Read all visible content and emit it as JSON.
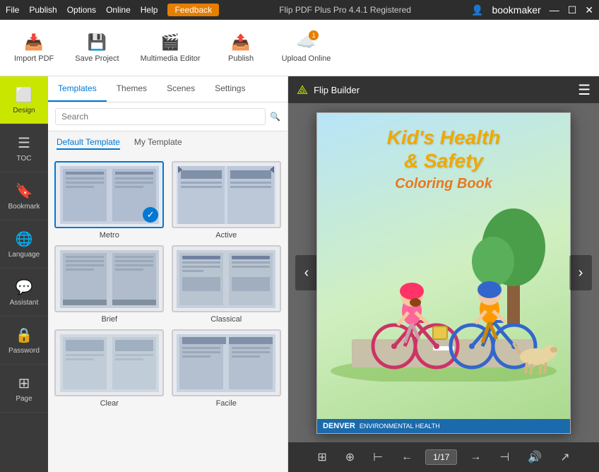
{
  "titlebar": {
    "menu_items": [
      "File",
      "Publish",
      "Options",
      "Online",
      "Help"
    ],
    "feedback_label": "Feedback",
    "app_title": "Flip PDF Plus Pro 4.4.1 Registered",
    "user_icon": "👤",
    "username": "bookmaker",
    "minimize": "—",
    "maximize": "☐",
    "close": "✕"
  },
  "toolbar": {
    "import_label": "Import PDF",
    "save_label": "Save Project",
    "multimedia_label": "Multimedia Editor",
    "publish_label": "Publish",
    "upload_label": "Upload Online"
  },
  "sidebar": {
    "items": [
      {
        "id": "design",
        "label": "Design",
        "icon": "⬜"
      },
      {
        "id": "toc",
        "label": "TOC",
        "icon": "☰"
      },
      {
        "id": "bookmark",
        "label": "Bookmark",
        "icon": "🔖"
      },
      {
        "id": "language",
        "label": "Language",
        "icon": "🌐"
      },
      {
        "id": "assistant",
        "label": "Assistant",
        "icon": "💬"
      },
      {
        "id": "password",
        "label": "Password",
        "icon": "🔒"
      },
      {
        "id": "page",
        "label": "Page",
        "icon": "⊞"
      }
    ]
  },
  "panel": {
    "tabs": [
      "Templates",
      "Themes",
      "Scenes",
      "Settings"
    ],
    "active_tab": "Templates",
    "search_placeholder": "Search",
    "sub_tabs": [
      "Default Template",
      "My Template"
    ],
    "active_sub_tab": "Default Template",
    "templates": [
      {
        "id": "metro",
        "name": "Metro",
        "selected": true
      },
      {
        "id": "active",
        "name": "Active",
        "selected": false
      },
      {
        "id": "brief",
        "name": "Brief",
        "selected": false
      },
      {
        "id": "classical",
        "name": "Classical",
        "selected": false
      },
      {
        "id": "clear",
        "name": "Clear",
        "selected": false
      },
      {
        "id": "facile",
        "name": "Facile",
        "selected": false
      },
      {
        "id": "more1",
        "name": "",
        "selected": false
      }
    ]
  },
  "preview": {
    "header_title": "Flip Builder",
    "book_title_line1": "Kid's Health",
    "book_title_line2": "& Safety",
    "book_subtitle": "Coloring Book",
    "page_current": "1",
    "page_total": "17",
    "page_display": "1/17",
    "footer_org": "DENVER",
    "footer_sub": "ENVIRONMENTAL HEALTH"
  },
  "icons": {
    "search": "🔍",
    "import": "📥",
    "save": "💾",
    "multimedia": "🎬",
    "publish": "📤",
    "upload": "☁️",
    "prev_arrow": "‹",
    "next_arrow": "›",
    "first_page": "⊢",
    "prev_page": "←",
    "next_page": "→",
    "last_page": "⊣",
    "grid": "⊞",
    "zoom_in": "⊕",
    "volume": "🔊",
    "share": "↗"
  }
}
